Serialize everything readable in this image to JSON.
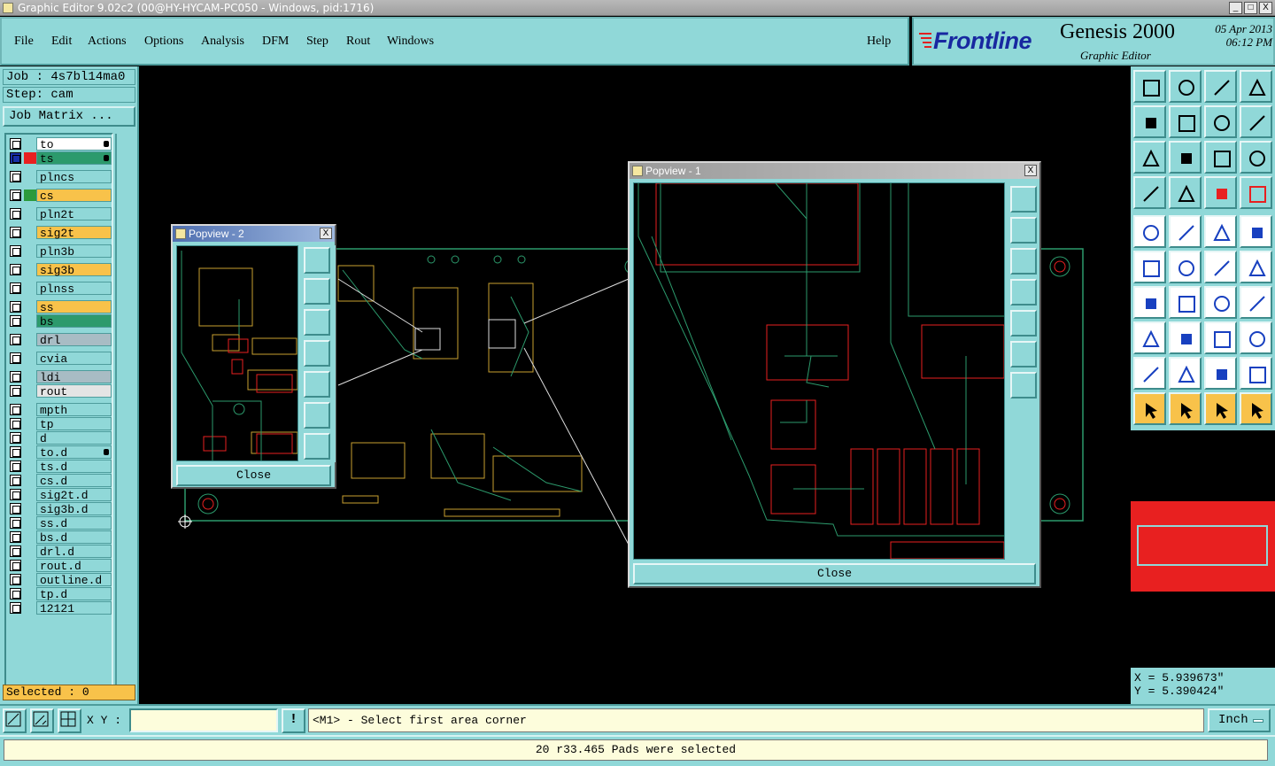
{
  "window": {
    "title": "Graphic Editor 9.02c2 (00@HY-HYCAM-PC050 - Windows, pid:1716)",
    "controls": [
      "_",
      "□",
      "X"
    ]
  },
  "menu": {
    "items": [
      {
        "label": "File"
      },
      {
        "label": "Edit"
      },
      {
        "label": "Actions"
      },
      {
        "label": "Options"
      },
      {
        "label": "Analysis"
      },
      {
        "label": "DFM"
      },
      {
        "label": "Step"
      },
      {
        "label": "Rout"
      },
      {
        "label": "Windows"
      }
    ],
    "help": "Help"
  },
  "brand": {
    "logo": "Frontline",
    "product": "Genesis 2000",
    "subtitle": "Graphic Editor",
    "date": "05 Apr 2013",
    "time": "06:12 PM"
  },
  "job": {
    "job_label": "Job : 4s7bl14ma0",
    "step_label": "Step: cam",
    "matrix_button": "Job Matrix ..."
  },
  "layers": [
    {
      "name": "to",
      "color": "#ffffff",
      "swatch": "#90d8d8",
      "marker": "hand"
    },
    {
      "name": "ts",
      "color": "#2c9a6c",
      "swatch": "#e82020",
      "active": true,
      "marker": "grid"
    },
    {
      "name": "plncs",
      "color": "#90d8d8",
      "swatch": "#90d8d8"
    },
    {
      "name": "cs",
      "color": "#f8c24a",
      "swatch": "#2c9a3c"
    },
    {
      "name": "pln2t",
      "color": "#90d8d8",
      "swatch": "#90d8d8"
    },
    {
      "name": "sig2t",
      "color": "#f8c24a",
      "swatch": "#90d8d8"
    },
    {
      "name": "pln3b",
      "color": "#90d8d8",
      "swatch": "#90d8d8"
    },
    {
      "name": "sig3b",
      "color": "#f8c24a",
      "swatch": "#90d8d8"
    },
    {
      "name": "plnss",
      "color": "#90d8d8",
      "swatch": "#90d8d8"
    },
    {
      "name": "ss",
      "color": "#f8c24a",
      "swatch": "#90d8d8"
    },
    {
      "name": "bs",
      "color": "#2c9a6c",
      "swatch": "#90d8d8"
    },
    {
      "name": "drl",
      "color": "#a8bcc4",
      "swatch": "#90d8d8"
    },
    {
      "name": "cvia",
      "color": "#90d8d8",
      "swatch": "#90d8d8"
    },
    {
      "name": "ldi",
      "color": "#a8bcc4",
      "swatch": "#90d8d8"
    },
    {
      "name": "rout",
      "color": "#e4e4e4",
      "swatch": "#90d8d8"
    },
    {
      "name": "mpth",
      "color": "#90d8d8",
      "swatch": "#90d8d8"
    },
    {
      "name": "tp",
      "color": "#90d8d8",
      "swatch": "#90d8d8"
    },
    {
      "name": "d",
      "color": "#90d8d8",
      "swatch": "#90d8d8"
    },
    {
      "name": "to.d",
      "color": "#90d8d8",
      "swatch": "#90d8d8",
      "marker": "hand"
    },
    {
      "name": "ts.d",
      "color": "#90d8d8",
      "swatch": "#90d8d8"
    },
    {
      "name": "cs.d",
      "color": "#90d8d8",
      "swatch": "#90d8d8"
    },
    {
      "name": "sig2t.d",
      "color": "#90d8d8",
      "swatch": "#90d8d8"
    },
    {
      "name": "sig3b.d",
      "color": "#90d8d8",
      "swatch": "#90d8d8"
    },
    {
      "name": "ss.d",
      "color": "#90d8d8",
      "swatch": "#90d8d8"
    },
    {
      "name": "bs.d",
      "color": "#90d8d8",
      "swatch": "#90d8d8"
    },
    {
      "name": "drl.d",
      "color": "#90d8d8",
      "swatch": "#90d8d8"
    },
    {
      "name": "rout.d",
      "color": "#90d8d8",
      "swatch": "#90d8d8"
    },
    {
      "name": "outline.d",
      "color": "#90d8d8",
      "swatch": "#90d8d8"
    },
    {
      "name": "tp.d",
      "color": "#90d8d8",
      "swatch": "#90d8d8"
    },
    {
      "name": "12121",
      "color": "#90d8d8",
      "swatch": "#90d8d8"
    }
  ],
  "selected": "Selected : 0",
  "popview1": {
    "title": "Popview - 1",
    "close": "Close",
    "x_glyph": "X"
  },
  "popview2": {
    "title": "Popview - 2",
    "close": "Close",
    "x_glyph": "X"
  },
  "coords": {
    "x": "X = 5.939673\"",
    "y": "Y = 5.390424\""
  },
  "bottom": {
    "xy_label": "X Y :",
    "xy_value": "",
    "alert_icon": "!",
    "prompt": "<M1> - Select first area corner",
    "unit": "Inch"
  },
  "status": "20 r33.465 Pads were selected",
  "colors": {
    "panel": "#90d8d8",
    "accent_orange": "#f8c24a",
    "board_green": "#2c9a6c",
    "highlight_red": "#e82020"
  },
  "tools": [
    "zoom-home-icon",
    "zoom-in-icon",
    "home-icon",
    "split-view-icon",
    "pan-left-icon",
    "pan-right-icon",
    "undo-view-icon",
    "redo-view-icon",
    "fit-icon",
    "center-icon",
    "scale-1to2-icon",
    "help-query-icon",
    "snap-icon",
    "grid-icon",
    "highlight-icon",
    "feature-select-icon",
    "add-pad-icon",
    "drc-icon",
    "measure-icon",
    "circle-icon",
    "connect-icon",
    "delete-icon",
    "move-icon",
    "copy-icon",
    "angle-icon",
    "line-icon",
    "arc-icon",
    "flip-icon",
    "dimension-icon",
    "cut-icon",
    "resize-icon",
    "merge-icon",
    "triangle-icon",
    "triangle-edit-icon",
    "arch-icon",
    "arch-edit-icon",
    "pointer-icon",
    "select-box-icon",
    "select-icon",
    "net-icon"
  ]
}
